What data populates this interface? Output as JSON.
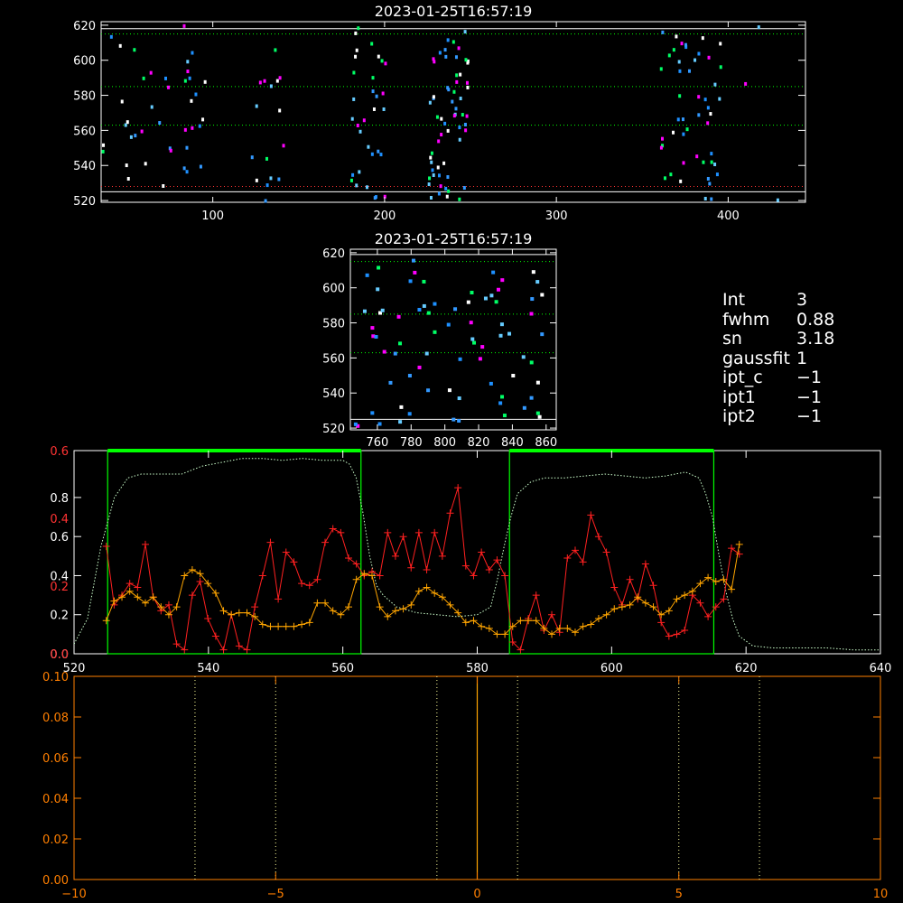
{
  "info_panel": {
    "items": [
      {
        "label": "Int",
        "value": "3"
      },
      {
        "label": "fwhm",
        "value": "0.88"
      },
      {
        "label": "sn",
        "value": "3.18"
      },
      {
        "label": "gaussfit",
        "value": "1"
      },
      {
        "label": "ipt_c",
        "value": "−1"
      },
      {
        "label": "ipt1",
        "value": "−1"
      },
      {
        "label": "ipt2",
        "value": "−1"
      }
    ]
  },
  "colors": {
    "background": "#000000",
    "axes": "#ffffff",
    "bottom_axes": "#ff7f00",
    "guide_green": "#00ff00",
    "trace_red": "#ff2020",
    "trace_orange": "#ffa500",
    "curve_light": "#ccffcc",
    "threshold_red": "#ff3333",
    "pixel_palette": [
      "#1e90ff",
      "#00ff66",
      "#ff00ff",
      "#3399ff",
      "#ffffff",
      "#66ccff"
    ]
  },
  "chart_data": [
    {
      "id": "full-frame",
      "type": "scatter",
      "title": "2023-01-25T16:57:19",
      "xlim": [
        35,
        445
      ],
      "ylim": [
        519,
        622
      ],
      "xticks": [
        100,
        200,
        300,
        400
      ],
      "yticks": [
        520,
        540,
        560,
        580,
        600,
        620
      ],
      "guide_lines": [
        {
          "y": 615,
          "color": "#00ff00",
          "style": "dotted"
        },
        {
          "y": 585,
          "color": "#00ff00",
          "style": "dotted"
        },
        {
          "y": 563,
          "color": "#00ff00",
          "style": "dotted"
        },
        {
          "y": 528,
          "color": "#ff3333",
          "style": "dotted"
        },
        {
          "y": 525,
          "color": "#ffffff",
          "style": "solid"
        },
        {
          "y": 618,
          "color": "#ffffff",
          "style": "solid"
        }
      ],
      "clusters": [
        {
          "x_range": [
            35,
            95
          ],
          "count": 40
        },
        {
          "x_range": [
            122,
            145
          ],
          "count": 16
        },
        {
          "x_range": [
            175,
            200
          ],
          "count": 32
        },
        {
          "x_range": [
            225,
            248
          ],
          "count": 60
        },
        {
          "x_range": [
            360,
            395
          ],
          "count": 48
        },
        {
          "x_range": [
            405,
            430
          ],
          "count": 3
        }
      ]
    },
    {
      "id": "zoom-frame",
      "type": "scatter",
      "title": "2023-01-25T16:57:19",
      "xlim": [
        744,
        866
      ],
      "ylim": [
        519,
        622
      ],
      "xticks": [
        760,
        780,
        800,
        820,
        840,
        860
      ],
      "yticks": [
        520,
        540,
        560,
        580,
        600,
        620
      ],
      "guide_lines": [
        {
          "y": 615,
          "color": "#00ff00",
          "style": "dotted"
        },
        {
          "y": 585,
          "color": "#00ff00",
          "style": "dotted"
        },
        {
          "y": 563,
          "color": "#00ff00",
          "style": "dotted"
        },
        {
          "y": 525,
          "color": "#ffffff",
          "style": "solid"
        },
        {
          "y": 619,
          "color": "#ffffff",
          "style": "solid"
        }
      ],
      "count": 75
    },
    {
      "id": "profile",
      "type": "line",
      "xlim": [
        520,
        640
      ],
      "xticks": [
        520,
        540,
        560,
        580,
        600,
        620,
        640
      ],
      "yticks_white": [
        0.0,
        0.2,
        0.4,
        0.6,
        0.8
      ],
      "ylim_white": [
        0,
        1.04
      ],
      "yticks_orange": [
        0.0,
        0.2,
        0.4,
        0.6
      ],
      "ylim_orange": [
        0,
        0.6
      ],
      "green_bands": [
        [
          525.0,
          562.7
        ],
        [
          584.8,
          615.2
        ]
      ],
      "light_curve": [
        [
          520,
          0.05
        ],
        [
          522,
          0.18
        ],
        [
          524,
          0.55
        ],
        [
          526,
          0.8
        ],
        [
          528,
          0.9
        ],
        [
          530,
          0.92
        ],
        [
          533,
          0.92
        ],
        [
          536,
          0.92
        ],
        [
          539,
          0.96
        ],
        [
          542,
          0.98
        ],
        [
          545,
          1.0
        ],
        [
          548,
          1.0
        ],
        [
          551,
          0.99
        ],
        [
          554,
          1.0
        ],
        [
          557,
          0.99
        ],
        [
          560,
          0.99
        ],
        [
          561,
          0.97
        ],
        [
          562,
          0.9
        ],
        [
          563,
          0.72
        ],
        [
          564,
          0.5
        ],
        [
          565,
          0.35
        ],
        [
          566,
          0.3
        ],
        [
          568,
          0.24
        ],
        [
          571,
          0.21
        ],
        [
          574,
          0.2
        ],
        [
          577,
          0.19
        ],
        [
          580,
          0.2
        ],
        [
          582,
          0.24
        ],
        [
          583,
          0.38
        ],
        [
          584,
          0.55
        ],
        [
          585,
          0.7
        ],
        [
          586,
          0.82
        ],
        [
          588,
          0.88
        ],
        [
          590,
          0.9
        ],
        [
          593,
          0.9
        ],
        [
          596,
          0.91
        ],
        [
          599,
          0.92
        ],
        [
          602,
          0.91
        ],
        [
          605,
          0.9
        ],
        [
          608,
          0.91
        ],
        [
          611,
          0.93
        ],
        [
          613,
          0.9
        ],
        [
          614,
          0.82
        ],
        [
          615,
          0.7
        ],
        [
          616,
          0.5
        ],
        [
          617,
          0.32
        ],
        [
          618,
          0.18
        ],
        [
          619,
          0.09
        ],
        [
          621,
          0.04
        ],
        [
          624,
          0.03
        ],
        [
          628,
          0.03
        ],
        [
          632,
          0.03
        ],
        [
          636,
          0.02
        ],
        [
          640,
          0.02
        ]
      ],
      "series_orange_values": [
        0.17,
        0.27,
        0.29,
        0.32,
        0.29,
        0.26,
        0.29,
        0.24,
        0.2,
        0.24,
        0.4,
        0.43,
        0.41,
        0.36,
        0.31,
        0.22,
        0.2,
        0.21,
        0.21,
        0.19,
        0.15,
        0.14,
        0.14,
        0.14,
        0.14,
        0.15,
        0.16,
        0.26,
        0.26,
        0.22,
        0.2,
        0.24,
        0.38,
        0.41,
        0.4,
        0.24,
        0.19,
        0.22,
        0.23,
        0.25,
        0.32,
        0.34,
        0.31,
        0.29,
        0.25,
        0.21,
        0.16,
        0.17,
        0.14,
        0.13,
        0.1,
        0.1,
        0.14,
        0.17,
        0.17,
        0.17,
        0.13,
        0.1,
        0.13,
        0.13,
        0.11,
        0.14,
        0.15,
        0.18,
        0.2,
        0.23,
        0.24,
        0.25,
        0.29,
        0.26,
        0.24,
        0.2,
        0.22,
        0.28,
        0.3,
        0.32,
        0.36,
        0.39,
        0.37,
        0.38,
        0.33,
        0.56
      ],
      "series_red_values": [
        0.55,
        0.25,
        0.3,
        0.36,
        0.34,
        0.56,
        0.29,
        0.22,
        0.25,
        0.05,
        0.02,
        0.3,
        0.37,
        0.18,
        0.09,
        0.02,
        0.2,
        0.04,
        0.02,
        0.24,
        0.4,
        0.57,
        0.28,
        0.52,
        0.47,
        0.36,
        0.35,
        0.38,
        0.57,
        0.64,
        0.62,
        0.49,
        0.46,
        0.4,
        0.42,
        0.4,
        0.62,
        0.5,
        0.6,
        0.44,
        0.62,
        0.43,
        0.62,
        0.5,
        0.72,
        0.85,
        0.45,
        0.4,
        0.52,
        0.43,
        0.48,
        0.4,
        0.06,
        0.02,
        0.18,
        0.3,
        0.12,
        0.2,
        0.11,
        0.49,
        0.53,
        0.47,
        0.71,
        0.6,
        0.52,
        0.34,
        0.25,
        0.38,
        0.28,
        0.46,
        0.35,
        0.16,
        0.09,
        0.1,
        0.12,
        0.3,
        0.26,
        0.19,
        0.24,
        0.28,
        0.54,
        0.51
      ]
    },
    {
      "id": "bottom-panel",
      "type": "line",
      "xlim": [
        -10,
        10
      ],
      "ylim": [
        0,
        0.1
      ],
      "xticks": [
        -10,
        -5,
        0,
        5,
        10
      ],
      "yticks": [
        "0.00",
        "0.02",
        "0.04",
        "0.06",
        "0.08",
        "0.10"
      ],
      "dotted_lines_x": [
        -7.0,
        -5.0,
        -1.0,
        1.0,
        5.0,
        7.0
      ],
      "solid_line_x": 0
    }
  ]
}
